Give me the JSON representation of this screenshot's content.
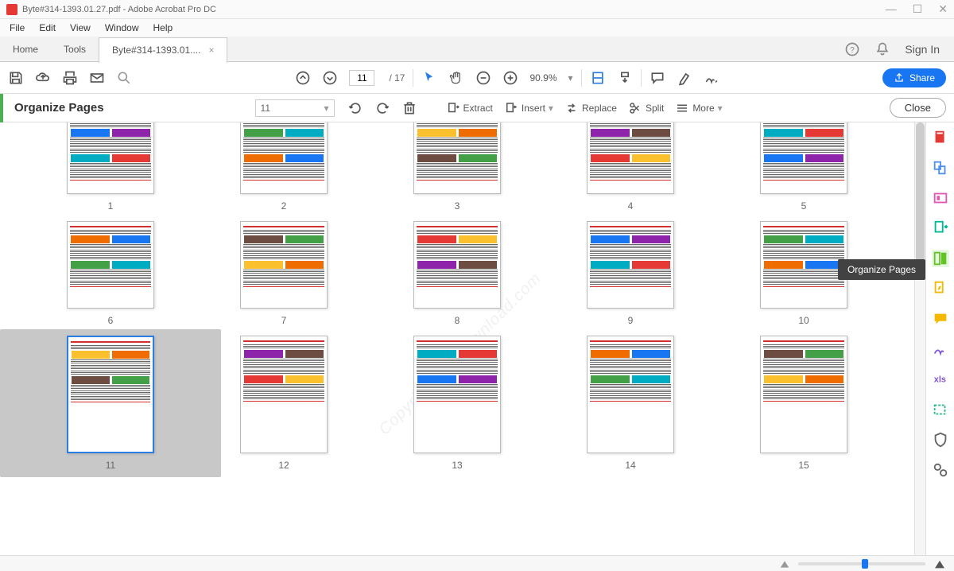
{
  "titlebar": {
    "title": "Byte#314-1393.01.27.pdf - Adobe Acrobat Pro DC"
  },
  "menubar": [
    "File",
    "Edit",
    "View",
    "Window",
    "Help"
  ],
  "tabs": {
    "home": "Home",
    "tools": "Tools",
    "doc": "Byte#314-1393.01....",
    "close": "×"
  },
  "tabright": {
    "signin": "Sign In"
  },
  "toolbar": {
    "page_current": "11",
    "page_sep": "/",
    "page_total": "17",
    "zoom": "90.9%",
    "share": "Share"
  },
  "subtoolbar": {
    "label": "Organize Pages",
    "page_dd": "11",
    "dd_caret": "▾",
    "extract": "Extract",
    "insert": "Insert",
    "replace": "Replace",
    "split": "Split",
    "more": "More",
    "close": "Close"
  },
  "tooltip": "Organize Pages",
  "thumbs": [
    {
      "n": "1"
    },
    {
      "n": "2"
    },
    {
      "n": "3"
    },
    {
      "n": "4"
    },
    {
      "n": "5"
    },
    {
      "n": "6"
    },
    {
      "n": "7"
    },
    {
      "n": "8"
    },
    {
      "n": "9"
    },
    {
      "n": "10"
    },
    {
      "n": "11"
    },
    {
      "n": "12"
    },
    {
      "n": "13"
    },
    {
      "n": "14"
    },
    {
      "n": "15"
    }
  ],
  "watermark": "Copyright p30download.com"
}
